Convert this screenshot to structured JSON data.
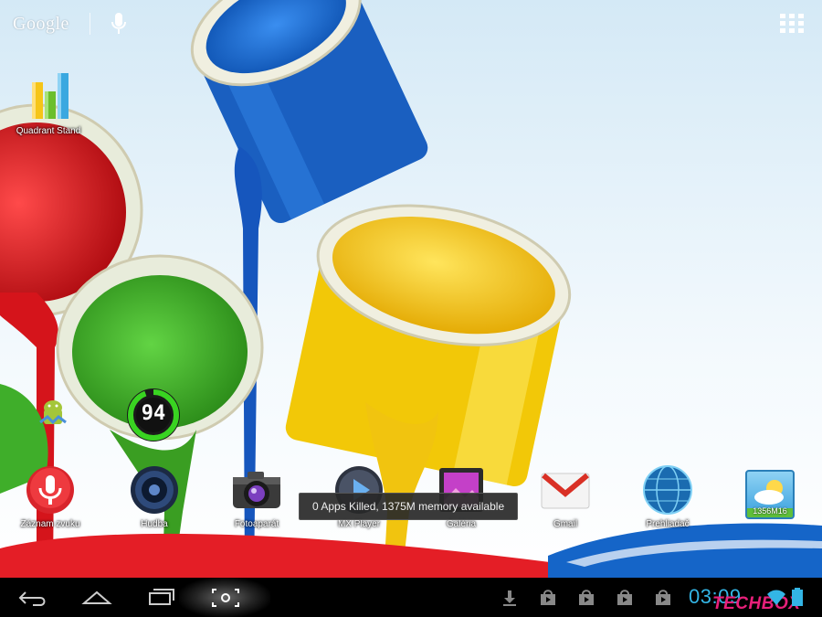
{
  "search": {
    "logo_text": "Google"
  },
  "apps_top": [
    {
      "label": "Quadrant Stand"
    }
  ],
  "widget": {
    "value": "94"
  },
  "dock": [
    {
      "label": "Záznam zvuku"
    },
    {
      "label": "Hudba"
    },
    {
      "label": "Fotoaparát"
    },
    {
      "label": "MX Player"
    },
    {
      "label": "Galéria"
    },
    {
      "label": "Gmail"
    },
    {
      "label": "Prehliadač"
    },
    {
      "label": "",
      "badge": "1356M16"
    }
  ],
  "toast": {
    "message": "0 Apps Killed, 1375M memory available"
  },
  "status": {
    "clock": "03:09",
    "watermark": "TECHBOX"
  },
  "colors": {
    "clock": "#33b5e5",
    "paint_red": "#e41e26",
    "paint_green": "#3fae2a",
    "paint_blue": "#1565c8",
    "paint_yellow": "#f6d10f"
  }
}
